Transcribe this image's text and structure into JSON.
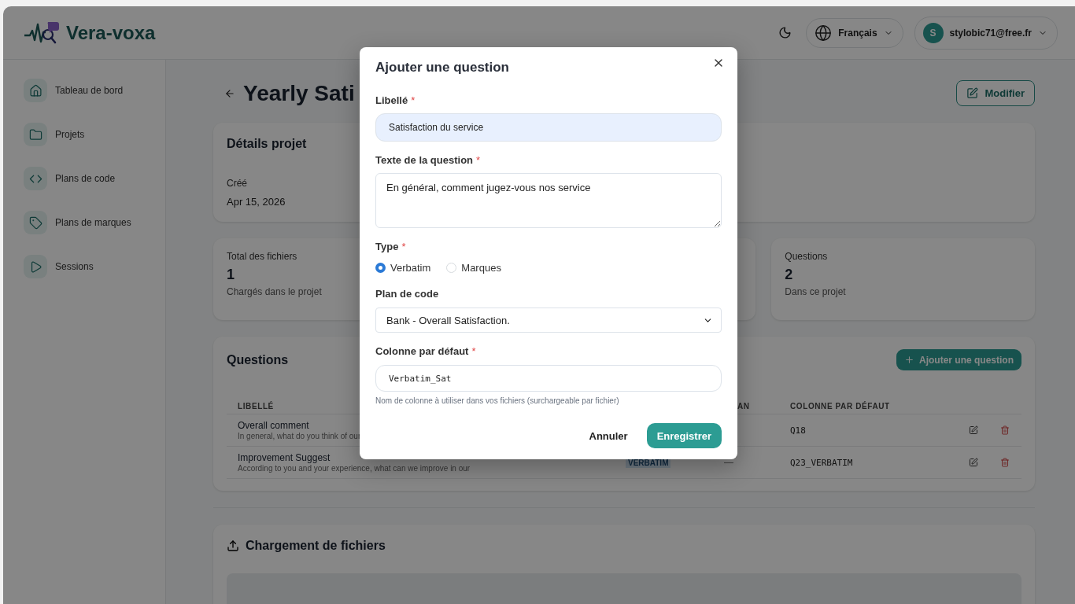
{
  "brand": {
    "name": "Vera-voxa"
  },
  "header": {
    "language": "Français",
    "user": {
      "initial": "S",
      "email": "stylobic71@free.fr"
    }
  },
  "sidebar": {
    "items": [
      {
        "label": "Tableau de bord",
        "kind": "home"
      },
      {
        "label": "Projets",
        "kind": "folder"
      },
      {
        "label": "Plans de code",
        "kind": "code"
      },
      {
        "label": "Plans de marques",
        "kind": "tag"
      },
      {
        "label": "Sessions",
        "kind": "play"
      }
    ]
  },
  "page": {
    "title": "Yearly Sati",
    "edit_button": "Modifier"
  },
  "details": {
    "title": "Détails projet",
    "fields": [
      {
        "label": "Créé",
        "value": "Apr 15, 2026"
      }
    ]
  },
  "stats": [
    {
      "label": "Total des fichiers",
      "value": "1",
      "note": "Chargés dans le projet"
    },
    {
      "label": "Questions",
      "value": "2",
      "note": "Dans ce projet"
    }
  ],
  "questions": {
    "title": "Questions",
    "add_button": "Ajouter une question",
    "columns": {
      "label": "LIBELLÉ",
      "column_3": "AN",
      "default_column": "COLONNE PAR DÉFAUT"
    },
    "rows": [
      {
        "label": "Overall comment",
        "text": "In general, what do you think of our",
        "default_column": "Q18"
      },
      {
        "label": "Improvement Suggest",
        "text": "According to you and your experience, what can we improve in our",
        "type": "VERBATIM",
        "column_3": "—",
        "default_column": "Q23_VERBATIM"
      }
    ]
  },
  "upload": {
    "title": "Chargement de fichiers"
  },
  "modal": {
    "title": "Ajouter une question",
    "label_field": {
      "label": "Libellé",
      "mark": "*",
      "value": "Satisfaction du service",
      "autofilled": true
    },
    "question_field": {
      "label": "Texte de la question",
      "mark": "*",
      "value": "En général, comment jugez-vous nos service"
    },
    "type_field": {
      "label": "Type",
      "mark": "*",
      "options": [
        {
          "label": "Verbatim",
          "selected": true
        },
        {
          "label": "Marques",
          "selected": false
        }
      ]
    },
    "code_plan_field": {
      "label": "Plan de code",
      "value": "Bank - Overall Satisfaction."
    },
    "column_field": {
      "label": "Colonne par défaut",
      "mark": "*",
      "value": "Verbatim_Sat",
      "hint": "Nom de colonne à utiliser dans vos fichiers (surchargeable par fichier)"
    },
    "buttons": {
      "cancel": "Annuler",
      "save": "Enregistrer"
    }
  }
}
